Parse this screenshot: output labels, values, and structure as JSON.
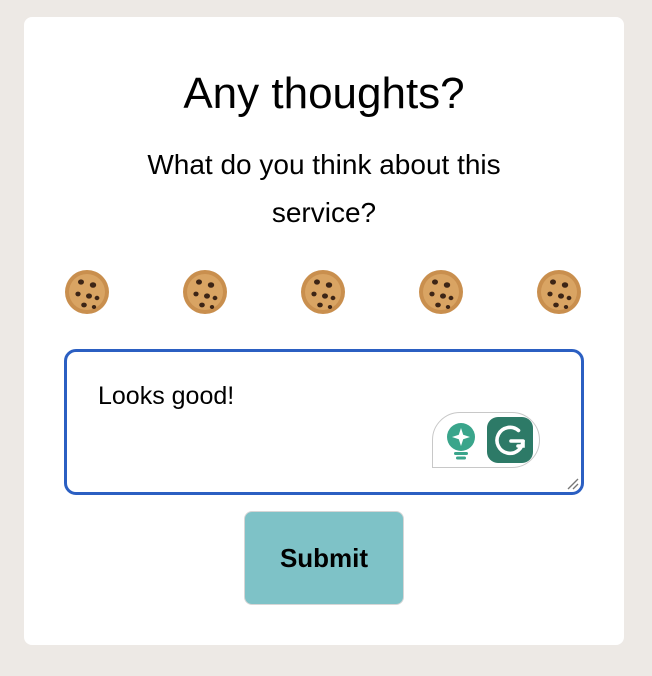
{
  "card": {
    "title": "Any thoughts?",
    "subtitle": "What do you think about this service?"
  },
  "rating": {
    "icon": "cookie-icon",
    "count": 5,
    "selected": 0
  },
  "feedback": {
    "value": "Looks good!"
  },
  "grammarly": {
    "suggestion_icon": "lightbulb-sparkle-icon",
    "logo_icon": "grammarly-g-icon",
    "accent": "#3aa58b",
    "logo_bg": "#2d7a67"
  },
  "submit": {
    "label": "Submit",
    "bg": "#7ec2c7"
  },
  "colors": {
    "page_bg": "#ede9e5",
    "card_bg": "#ffffff",
    "focus_border": "#2b5fc2"
  }
}
